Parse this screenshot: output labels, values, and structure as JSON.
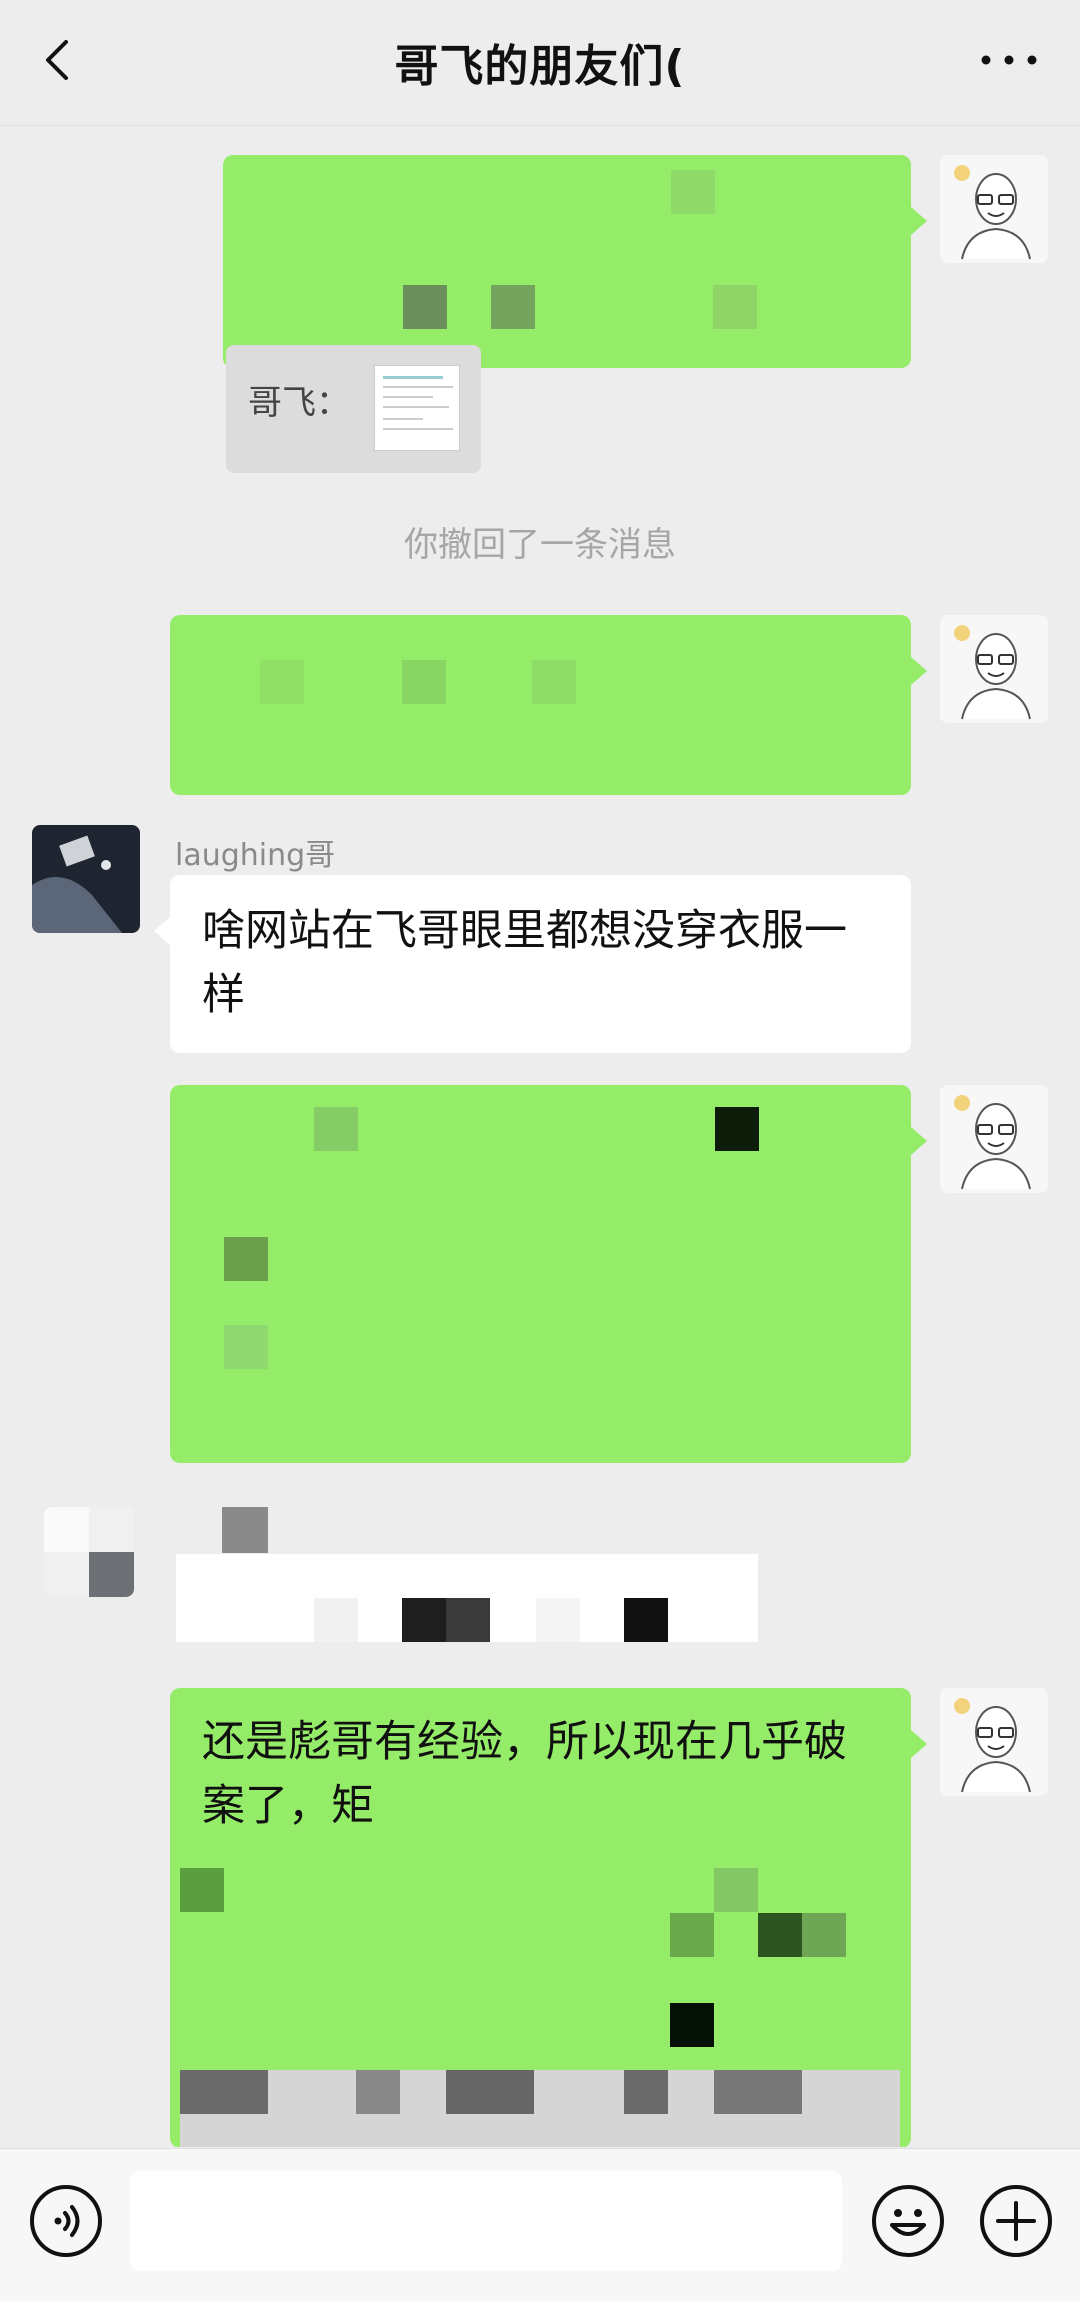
{
  "header": {
    "title": "哥飞的朋友们("
  },
  "messages": {
    "quote_sender": "哥飞：",
    "system_notice": "你撤回了一条消息",
    "sender_name": "laughing哥",
    "friend_message_line1": "啥网站在飞哥眼里都想没穿衣服一",
    "friend_message_line2": "样",
    "my_message_line1": "还是彪哥有经验，所以现在几乎破",
    "my_message_line2": "案了，矩"
  },
  "colors": {
    "my_bubble": "#95ec69",
    "friend_bubble": "#ffffff",
    "background": "#ededed"
  },
  "icons": {
    "back": "chevron-left-icon",
    "more": "more-dots-icon",
    "voice": "voice-icon",
    "emoji": "emoji-icon",
    "plus": "plus-icon"
  }
}
